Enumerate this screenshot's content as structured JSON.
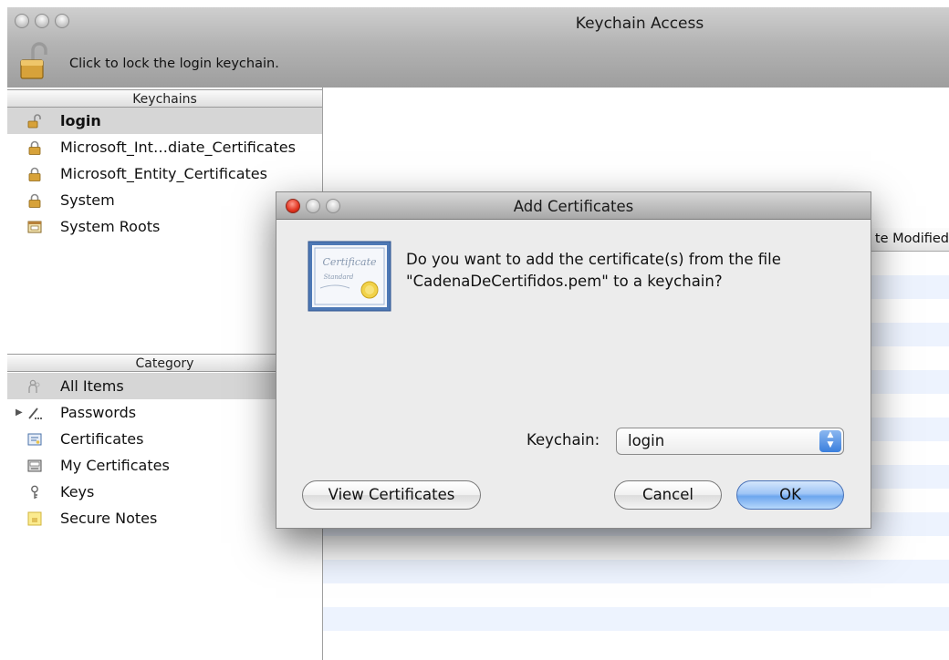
{
  "window": {
    "title": "Keychain Access",
    "lock_hint": "Click to lock the login keychain."
  },
  "sidebar": {
    "keychains_header": "Keychains",
    "keychains": [
      {
        "label": "login",
        "icon": "unlocked-padlock-icon",
        "selected": true
      },
      {
        "label": "Microsoft_Int…diate_Certificates",
        "icon": "padlock-icon"
      },
      {
        "label": "Microsoft_Entity_Certificates",
        "icon": "padlock-icon"
      },
      {
        "label": "System",
        "icon": "padlock-icon"
      },
      {
        "label": "System Roots",
        "icon": "cabinet-icon"
      }
    ],
    "category_header": "Category",
    "categories": [
      {
        "label": "All Items",
        "icon": "people-icon",
        "selected": true
      },
      {
        "label": "Passwords",
        "icon": "pen-icon",
        "expandable": true
      },
      {
        "label": "Certificates",
        "icon": "certificate-icon"
      },
      {
        "label": "My Certificates",
        "icon": "my-certificate-icon"
      },
      {
        "label": "Keys",
        "icon": "key-icon"
      },
      {
        "label": "Secure Notes",
        "icon": "note-icon"
      }
    ]
  },
  "table": {
    "visible_column": "te Modified"
  },
  "dialog": {
    "title": "Add Certificates",
    "message_line1": "Do you want to add the certificate(s) from the file",
    "message_line2": "\"CadenaDeCertifidos.pem\" to a keychain?",
    "keychain_label": "Keychain:",
    "keychain_value": "login",
    "view_button": "View Certificates",
    "cancel_button": "Cancel",
    "ok_button": "OK",
    "certificate_graphic_text": "Certificate Standard"
  },
  "colors": {
    "selection": "#d6d6d6",
    "stripe": "#edf3fe",
    "default_button": "#6da6ee",
    "close_button": "#e0321e"
  }
}
